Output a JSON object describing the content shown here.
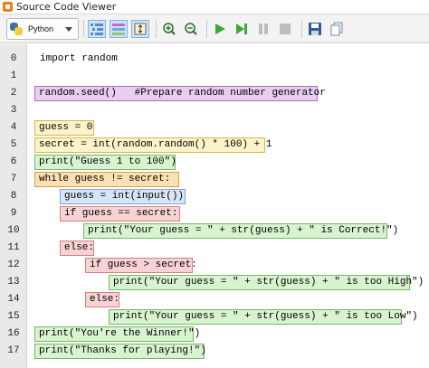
{
  "window": {
    "title": "Source Code Viewer"
  },
  "toolbar": {
    "language": "Python",
    "buttons": [
      "view-blocks-icon",
      "view-colors-icon",
      "fit-icon",
      "zoom-in-icon",
      "zoom-out-icon",
      "run-icon",
      "step-icon",
      "pause-icon",
      "stop-icon",
      "save-icon",
      "copy-icon"
    ]
  },
  "colors": {
    "purple": "#e8cdf0",
    "yellow": "#fdf3c9",
    "orange": "#fbe0b3",
    "blue": "#d6e6f8",
    "red": "#f9d3d3",
    "green": "#d8f3cf",
    "run_green": "#3aa83a"
  },
  "line_numbers": [
    "0",
    "1",
    "2",
    "3",
    "4",
    "5",
    "6",
    "7",
    "8",
    "9",
    "10",
    "11",
    "12",
    "13",
    "14",
    "15",
    "16",
    "17"
  ],
  "code": {
    "lines": [
      "import random",
      "",
      "random.seed()   #Prepare random number generator",
      "",
      "guess = 0",
      "secret = int(random.random() * 100) + 1",
      "print(\"Guess 1 to 100\")",
      "while guess != secret:",
      "guess = int(input())",
      "if guess == secret:",
      "print(\"Your guess = \" + str(guess) + \" is Correct!\")",
      "else:",
      "if guess > secret:",
      "print(\"Your guess = \" + str(guess) + \" is too High\")",
      "else:",
      "print(\"Your guess = \" + str(guess) + \" is too Low\")",
      "print(\"You're the Winner!\")",
      "print(\"Thanks for playing!\")"
    ]
  }
}
